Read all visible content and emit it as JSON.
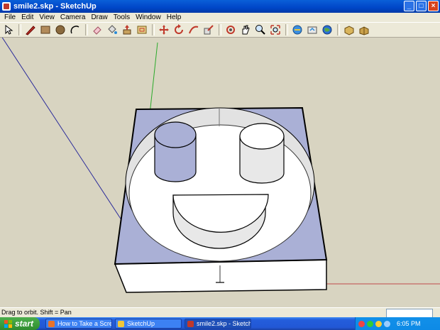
{
  "window": {
    "title": "smile2.skp - SketchUp",
    "buttons": {
      "minimize": "_",
      "maximize": "□",
      "close": "×"
    }
  },
  "menu": [
    "File",
    "Edit",
    "View",
    "Camera",
    "Draw",
    "Tools",
    "Window",
    "Help"
  ],
  "toolbar": [
    "select-arrow-icon",
    "pencil-line-icon",
    "rectangle-icon",
    "circle-icon",
    "arc-icon",
    "eraser-icon",
    "paint-bucket-icon",
    "push-pull-icon",
    "offset-icon",
    "move-icon",
    "rotate-icon",
    "follow-me-icon",
    "scale-icon",
    "orbit-icon",
    "pan-icon",
    "zoom-icon",
    "zoom-extents-icon",
    "get-models-icon",
    "share-model-icon",
    "google-earth-icon",
    "components-icon",
    "make-component-icon"
  ],
  "status": {
    "hint": "Drag to orbit.  Shift = Pan"
  },
  "taskbar": {
    "start_label": "start",
    "tasks": [
      {
        "label": "How to Take a Scree..."
      },
      {
        "label": "SketchUp"
      },
      {
        "label": "smile2.skp - SketchUp"
      }
    ],
    "clock": "6:05 PM"
  },
  "colors": {
    "model_face_blue": "#aab0d6",
    "model_face_white": "#ffffff",
    "viewport_bg": "#d8d4c1",
    "taskbar_blue": "#245edc"
  }
}
